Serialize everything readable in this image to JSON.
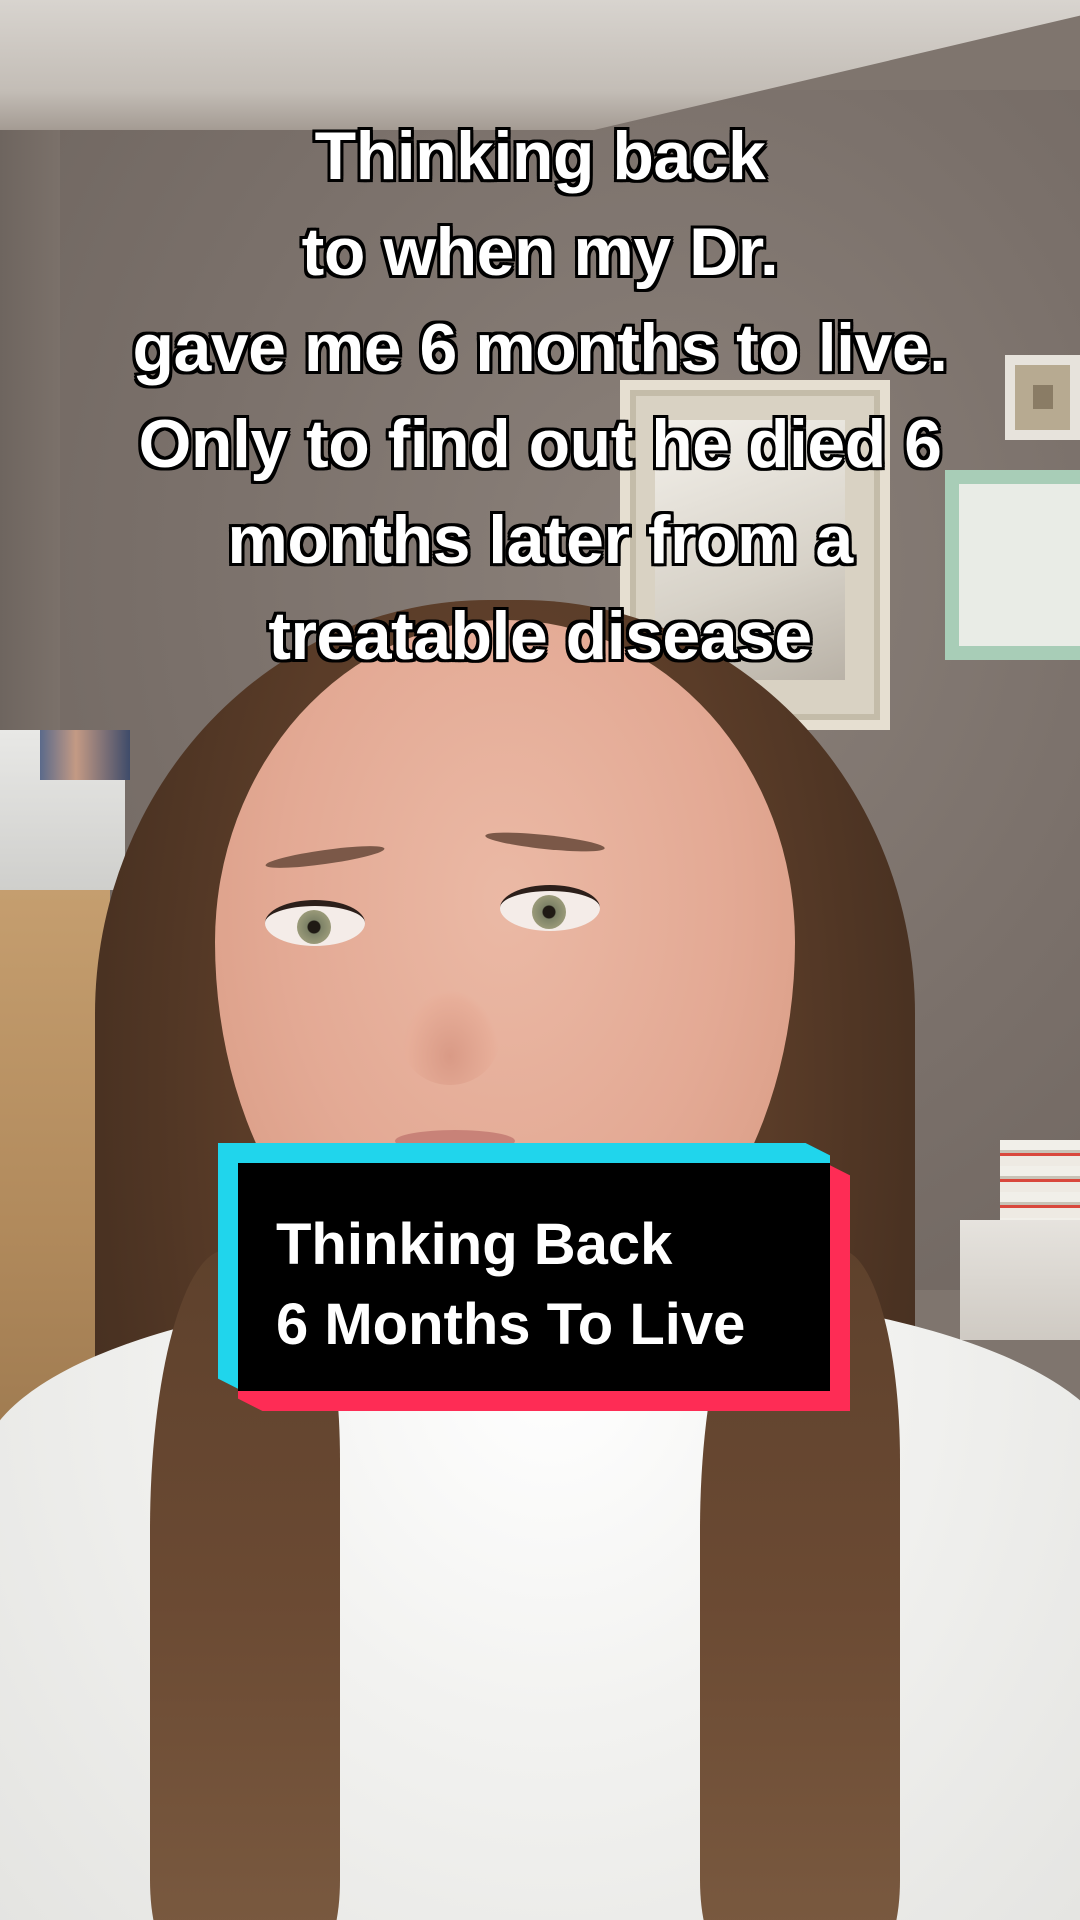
{
  "caption": {
    "lines": [
      "Thinking back",
      "to when my Dr.",
      "gave me 6 months to live.",
      "Only to find out he died 6",
      "months later from a",
      "treatable disease"
    ]
  },
  "title_card": {
    "line1": "Thinking Back",
    "line2": "6 Months To Live",
    "colors": {
      "cyan": "#20d5ec",
      "red": "#fe2c55",
      "background": "#000000",
      "text": "#ffffff"
    }
  }
}
